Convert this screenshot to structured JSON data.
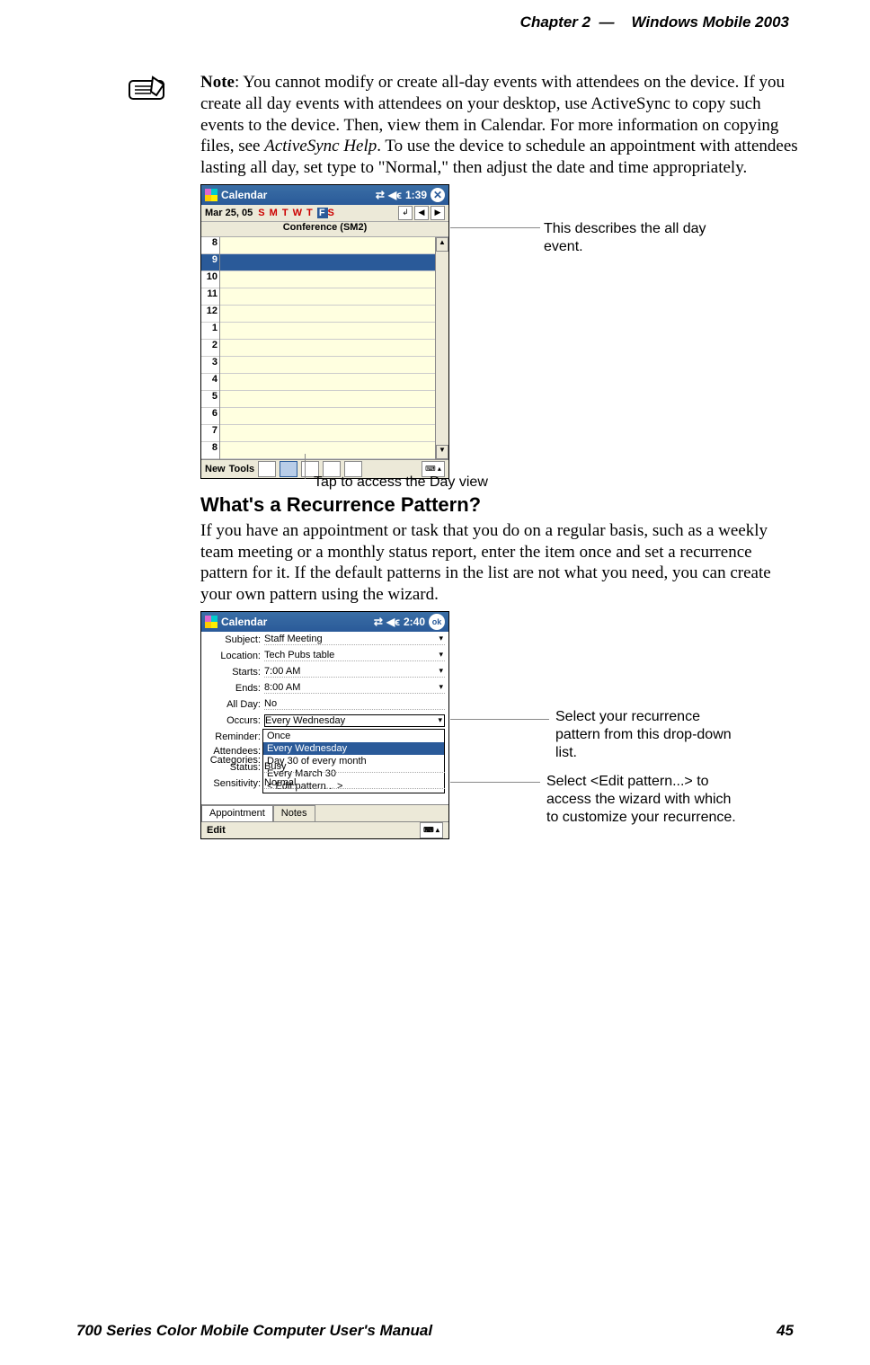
{
  "header": {
    "chapter": "Chapter  2",
    "dash": "—",
    "title": "Windows Mobile 2003"
  },
  "note": {
    "label": "Note",
    "text_before_italic": ": You cannot modify or create all-day events with attendees on the device. If you create all day events with attendees on your desktop, use ActiveSync to copy such events to the device. Then, view them in Calendar. For more information on copying files, see ",
    "italic": "ActiveSync Help",
    "text_after_italic": ". To use the device to schedule an appointment with attendees lasting all day, set type to \"Normal,\" then adjust the date and time appropriately."
  },
  "shot1": {
    "title": "Calendar",
    "time": "1:39",
    "date": "Mar 25, 05",
    "weekdays": "S M T W T",
    "weekday_f": "F",
    "weekday_s": "S",
    "event": "Conference (SM2)",
    "hours": [
      "8",
      "9",
      "10",
      "11",
      "12",
      "1",
      "2",
      "3",
      "4",
      "5",
      "6",
      "7",
      "8"
    ],
    "bottom": {
      "new": "New",
      "tools": "Tools"
    }
  },
  "callouts": {
    "c1": "This describes the all day event.",
    "c2": "Tap to access the Day view",
    "c3": "Select your recurrence pattern from this drop-down list.",
    "c4": "Select <Edit pattern...> to access the wizard with which to customize your recurrence."
  },
  "section2": {
    "head": "What's a Recurrence Pattern?",
    "body": "If you have an appointment or task that you do on a regular basis, such as a weekly team meeting or a monthly status report, enter the item once and set a recurrence pattern for it. If the default patterns in the list are not what you need, you can create your own pattern using the wizard."
  },
  "shot2": {
    "title": "Calendar",
    "time": "2:40",
    "ok": "ok",
    "fields": {
      "Subject": "Staff Meeting",
      "Location": "Tech Pubs table",
      "Starts": "7:00 AM",
      "Ends": "8:00 AM",
      "All Day": "No",
      "Occurs": "Every Wednesday",
      "Reminder": "",
      "Categories": "",
      "Attendees": "",
      "Status": "Busy",
      "Sensitivity": "Normal"
    },
    "occurs_options": [
      "Once",
      "Every Wednesday",
      "Day 30 of every month",
      "Every March 30",
      "< Edit pattern... >"
    ],
    "tabs": [
      "Appointment",
      "Notes"
    ],
    "edit": "Edit"
  },
  "footer": {
    "left": "700 Series Color Mobile Computer User's Manual",
    "right": "45"
  }
}
